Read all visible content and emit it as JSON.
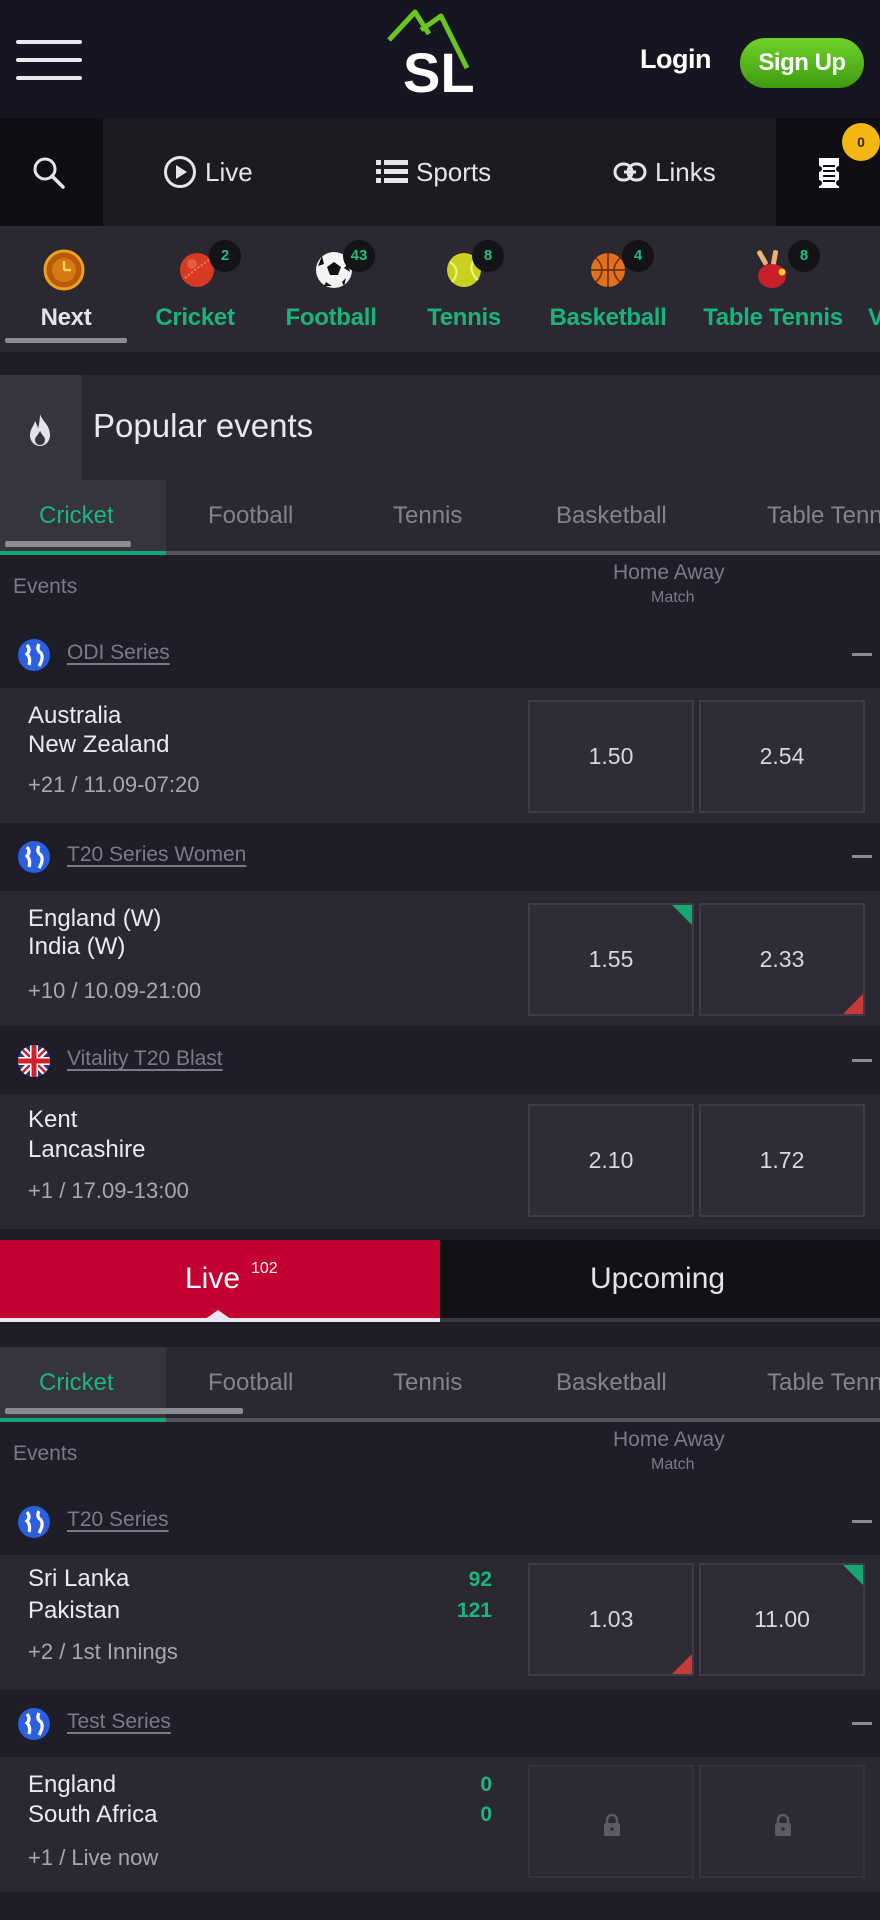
{
  "header": {
    "logo_text": "SL",
    "login_label": "Login",
    "signup_label": "Sign Up"
  },
  "nav": {
    "items": [
      {
        "label": "Live",
        "icon": "play-circle-icon"
      },
      {
        "label": "Sports",
        "icon": "list-icon"
      },
      {
        "label": "Links",
        "icon": "link-icon"
      }
    ],
    "betslip_count": "0"
  },
  "sports_strip": [
    {
      "label": "Next",
      "count": null,
      "icon": "clock-icon"
    },
    {
      "label": "Cricket",
      "count": "2",
      "icon": "cricket-ball-icon"
    },
    {
      "label": "Football",
      "count": "43",
      "icon": "football-icon"
    },
    {
      "label": "Tennis",
      "count": "8",
      "icon": "tennis-ball-icon"
    },
    {
      "label": "Basketball",
      "count": "4",
      "icon": "basketball-icon"
    },
    {
      "label": "Table Tennis",
      "count": "8",
      "icon": "table-tennis-icon"
    },
    {
      "label": "V",
      "count": null,
      "icon": null
    }
  ],
  "popular": {
    "title": "Popular events",
    "tabs": [
      "Cricket",
      "Football",
      "Tennis",
      "Basketball",
      "Table Tennis"
    ],
    "active_tab": "Cricket",
    "columns": {
      "events": "Events",
      "home_away": "Home Away",
      "market": "Match"
    },
    "leagues": [
      {
        "name": "ODI Series",
        "flag": "world",
        "matches": [
          {
            "home": "Australia",
            "away": "New Zealand",
            "meta": "+21 / 11.09-07:20",
            "odds": [
              "1.50",
              "2.54"
            ],
            "trend": [
              null,
              null
            ]
          }
        ]
      },
      {
        "name": "T20 Series Women",
        "flag": "world",
        "matches": [
          {
            "home": "England (W)",
            "away": "India (W)",
            "meta": "+10 / 10.09-21:00",
            "odds": [
              "1.55",
              "2.33"
            ],
            "trend": [
              "up",
              "down"
            ]
          }
        ]
      },
      {
        "name": "Vitality T20 Blast",
        "flag": "uk",
        "matches": [
          {
            "home": "Kent",
            "away": "Lancashire",
            "meta": "+1 / 17.09-13:00",
            "odds": [
              "2.10",
              "1.72"
            ],
            "trend": [
              null,
              null
            ]
          }
        ]
      }
    ]
  },
  "live_upcoming": {
    "live_label": "Live",
    "live_count": "102",
    "upcoming_label": "Upcoming",
    "active": "Live"
  },
  "live": {
    "tabs": [
      "Cricket",
      "Football",
      "Tennis",
      "Basketball",
      "Table Tennis"
    ],
    "active_tab": "Cricket",
    "columns": {
      "events": "Events",
      "home_away": "Home Away",
      "market": "Match"
    },
    "leagues": [
      {
        "name": "T20 Series",
        "flag": "world",
        "matches": [
          {
            "home": "Sri Lanka",
            "away": "Pakistan",
            "home_score": "92",
            "away_score": "121",
            "meta": "+2 / 1st Innings",
            "odds": [
              "1.03",
              "11.00"
            ],
            "trend": [
              "down",
              "up"
            ],
            "locked": false
          }
        ]
      },
      {
        "name": "Test Series",
        "flag": "world",
        "matches": [
          {
            "home": "England",
            "away": "South Africa",
            "home_score": "0",
            "away_score": "0",
            "meta": "+1 / Live now",
            "odds": [
              "",
              ""
            ],
            "trend": [
              null,
              null
            ],
            "locked": true
          }
        ]
      }
    ]
  },
  "colors": {
    "accent_green": "#19b77e",
    "signup_green": "#5cbf1f",
    "live_red": "#c3002f",
    "badge_yellow": "#f2b811",
    "odds_up": "#16a673",
    "odds_down": "#c83a3a"
  }
}
